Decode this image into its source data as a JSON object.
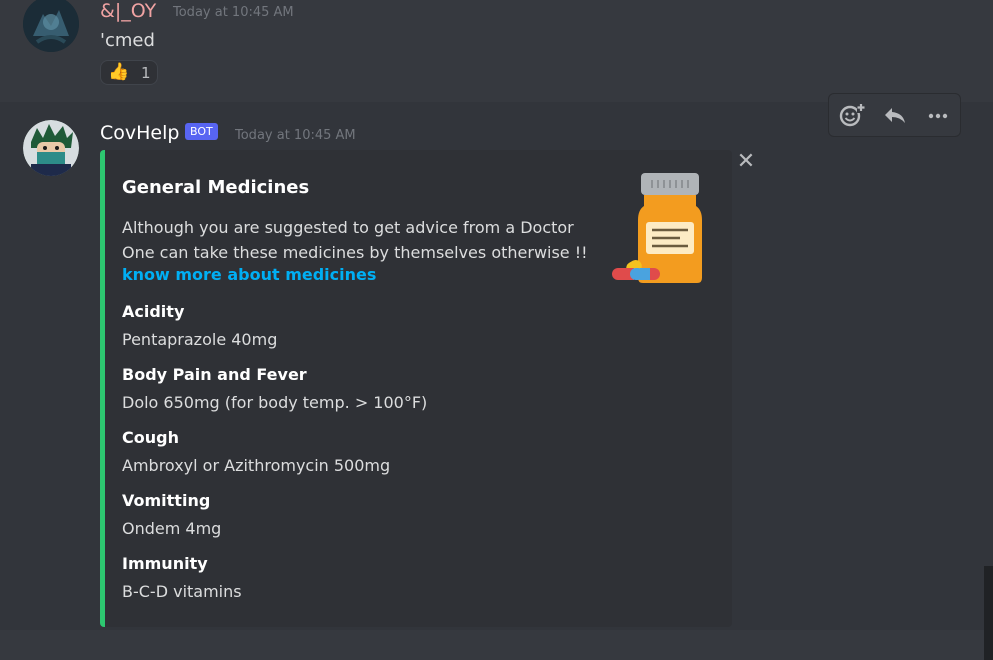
{
  "message1": {
    "username": "&|_OY",
    "timestamp": "Today at 10:45 AM",
    "text": "'cmed",
    "reaction": {
      "emoji": "👍",
      "count": "1"
    },
    "username_color": "#f0a3a3"
  },
  "message2": {
    "username": "CovHelp",
    "bot_badge": "BOT",
    "timestamp": "Today at 10:45 AM",
    "accent_color": "#2dc770",
    "embed": {
      "title": "General Medicines",
      "description_line1": "Although you are suggested to get advice from a Doctor",
      "description_line2": "One can take these medicines by themselves otherwise !!",
      "link_text": "know more about medicines",
      "thumbnail_icon": "medicine-bottle-icon",
      "fields": [
        {
          "name": "Acidity",
          "value": "Pentaprazole 40mg"
        },
        {
          "name": "Body Pain and Fever",
          "value": "Dolo 650mg (for body temp. > 100°F)"
        },
        {
          "name": "Cough",
          "value": "Ambroxyl or Azithromycin 500mg"
        },
        {
          "name": "Vomitting",
          "value": "Ondem 4mg"
        },
        {
          "name": "Immunity",
          "value": "B-C-D vitamins"
        }
      ]
    }
  },
  "toolbar": {
    "icons": [
      "add-reaction-icon",
      "reply-icon",
      "more-icon"
    ]
  }
}
